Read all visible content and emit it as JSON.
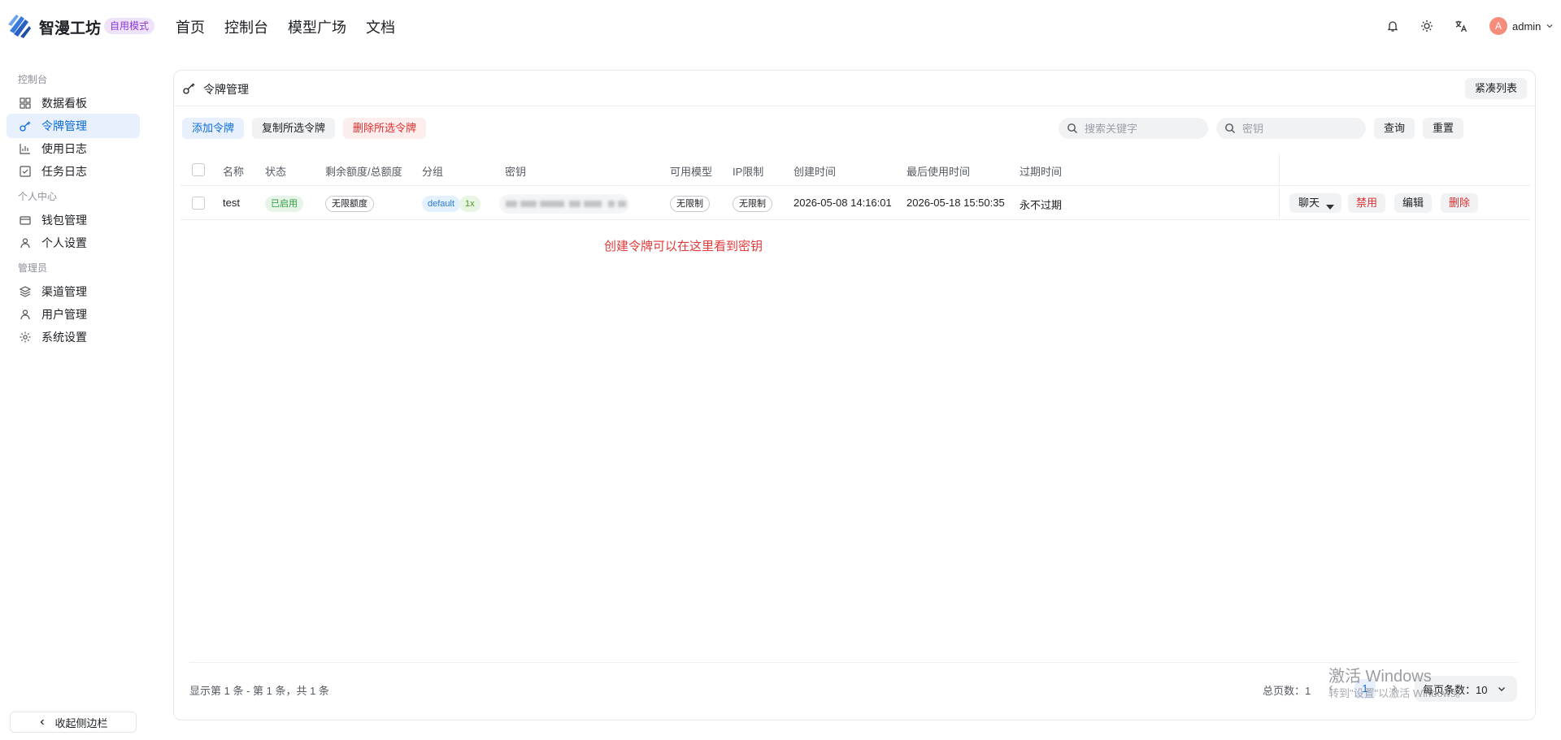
{
  "header": {
    "brand": "智漫工坊",
    "mode_badge": "自用模式",
    "nav": [
      "首页",
      "控制台",
      "模型广场",
      "文档"
    ],
    "user": {
      "avatar_letter": "A",
      "name": "admin"
    }
  },
  "sidebar": {
    "groups": [
      {
        "title": "控制台",
        "items": [
          {
            "label": "数据看板",
            "icon": "dashboard-icon"
          },
          {
            "label": "令牌管理",
            "icon": "key-icon",
            "active": true
          },
          {
            "label": "使用日志",
            "icon": "bar-chart-icon"
          },
          {
            "label": "任务日志",
            "icon": "checklist-icon"
          }
        ]
      },
      {
        "title": "个人中心",
        "items": [
          {
            "label": "钱包管理",
            "icon": "wallet-icon"
          },
          {
            "label": "个人设置",
            "icon": "user-icon"
          }
        ]
      },
      {
        "title": "管理员",
        "items": [
          {
            "label": "渠道管理",
            "icon": "layers-icon"
          },
          {
            "label": "用户管理",
            "icon": "user-icon"
          },
          {
            "label": "系统设置",
            "icon": "gear-icon"
          }
        ]
      }
    ],
    "collapse_label": "收起侧边栏"
  },
  "page": {
    "title": "令牌管理",
    "compact_label": "紧凑列表",
    "toolbar": {
      "add": "添加令牌",
      "copy": "复制所选令牌",
      "delete": "删除所选令牌"
    },
    "search": {
      "keyword_placeholder": "搜索关键字",
      "key_placeholder": "密钥",
      "query": "查询",
      "reset": "重置"
    },
    "columns": [
      "名称",
      "状态",
      "剩余额度/总额度",
      "分组",
      "密钥",
      "可用模型",
      "IP限制",
      "创建时间",
      "最后使用时间",
      "过期时间"
    ],
    "rows": [
      {
        "name": "test",
        "status": "已启用",
        "quota": "无限额度",
        "group": "default",
        "ratio": "1x",
        "models": "无限制",
        "ip_limit": "无限制",
        "created": "2026-05-08 14:16:01",
        "last_used": "2026-05-18 15:50:35",
        "expires": "永不过期",
        "actions": {
          "chat": "聊天",
          "disable": "禁用",
          "edit": "编辑",
          "delete": "删除"
        }
      }
    ],
    "annotation": "创建令牌可以在这里看到密钥",
    "footer": {
      "range_text": "显示第 1 条 - 第 1 条，共 1 条",
      "total_pages": "总页数：1",
      "current_page": "1",
      "page_size_label": "每页条数：10"
    }
  },
  "watermark": {
    "title": "激活 Windows",
    "subtitle": "转到\"设置\"以激活 Windows。"
  },
  "colors": {
    "accent": "#0b6bdc",
    "danger": "#e02d2d",
    "success": "#2c9c3d",
    "badge_purple": "#8a3bd1"
  }
}
